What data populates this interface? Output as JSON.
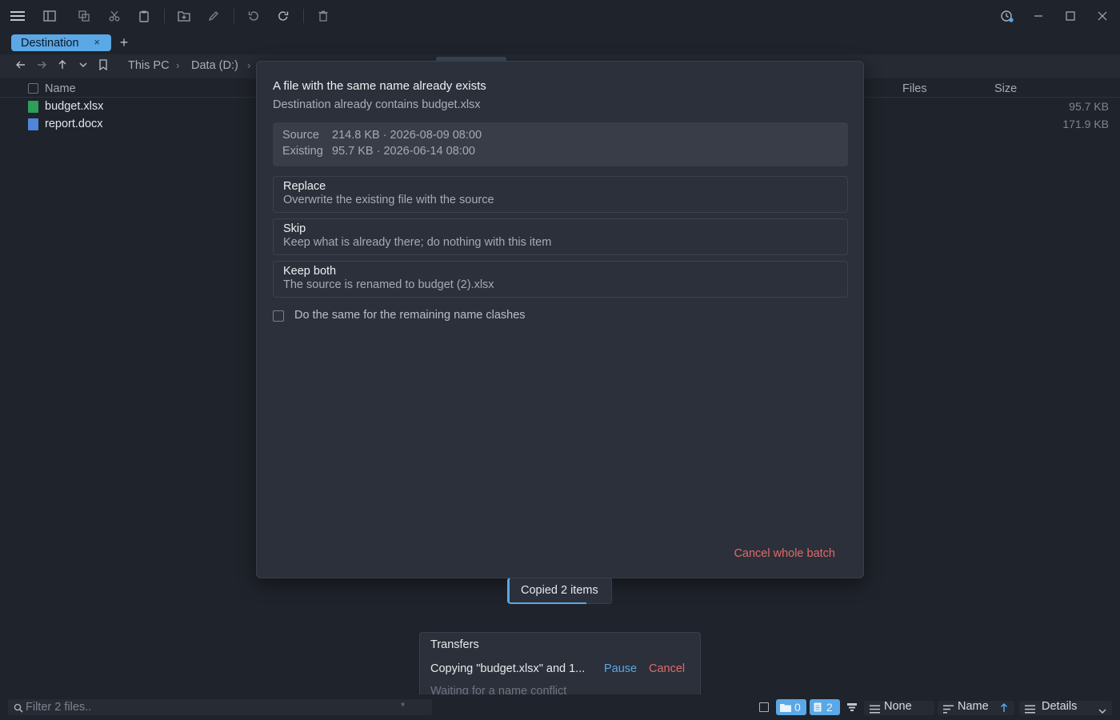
{
  "toolbar": {
    "icons": [
      "menu-icon",
      "sidebar-icon",
      "copy-icon",
      "cut-icon",
      "paste-icon",
      "new-folder-icon",
      "rename-icon",
      "undo-icon",
      "redo-icon",
      "delete-icon",
      "history-icon",
      "minimize-icon",
      "maximize-icon",
      "close-icon"
    ]
  },
  "tabs": [
    {
      "label": "Destination",
      "close": "×"
    }
  ],
  "tab_add": "+",
  "breadcrumb": [
    "This PC",
    "Data (D:)"
  ],
  "columns": {
    "name": "Name",
    "files": "Files",
    "size": "Size"
  },
  "files": [
    {
      "name": "budget.xlsx",
      "size": "95.7 KB",
      "type": "excel",
      "color": "#2e9e5b"
    },
    {
      "name": "report.docx",
      "size": "171.9 KB",
      "type": "word",
      "color": "#4f86d9"
    }
  ],
  "dialog": {
    "title": "A file with the same name already exists",
    "subtitle": "Destination already contains budget.xlsx",
    "source_label": "Source",
    "source_value": "214.8 KB · 2026-08-09 08:00",
    "existing_label": "Existing",
    "existing_value": "95.7 KB · 2026-06-14 08:00",
    "options": [
      {
        "title": "Replace",
        "desc": "Overwrite the existing file with the source"
      },
      {
        "title": "Skip",
        "desc": "Keep what is already there; do nothing with this item"
      },
      {
        "title": "Keep both",
        "desc": "The source is renamed to budget (2).xlsx"
      }
    ],
    "apply_all": "Do the same for the remaining name clashes",
    "cancel_batch": "Cancel whole batch"
  },
  "toast": {
    "text": "Copied 2 items",
    "progress": 0.73
  },
  "transfers": {
    "title": "Transfers",
    "job": "Copying \"budget.xlsx\" and 1...",
    "pause": "Pause",
    "cancel": "Cancel",
    "status": "Waiting for a name conflict"
  },
  "statusbar": {
    "filter_placeholder": "Filter 2 files..",
    "folders_count": "0",
    "files_count": "2",
    "group": "None",
    "sort": "Name",
    "view": "Details"
  },
  "colors": {
    "accent": "#5aa8e6",
    "danger": "#e06a6a",
    "background": "#1f232b",
    "dialog": "#2b303a"
  }
}
